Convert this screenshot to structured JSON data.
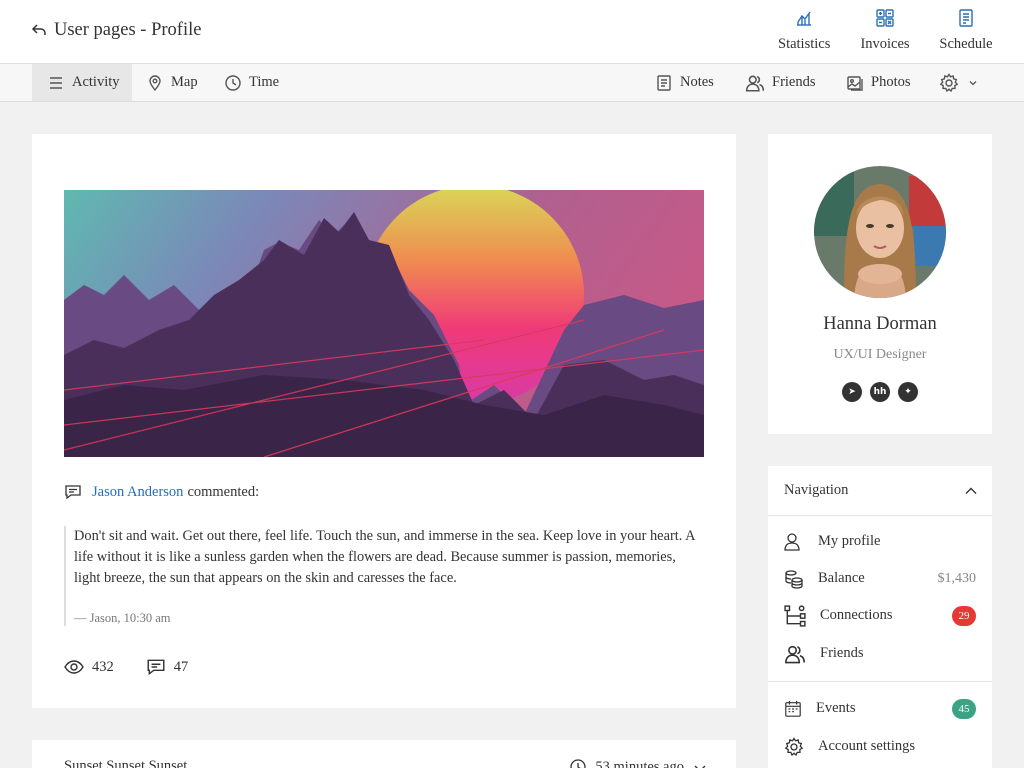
{
  "header": {
    "title": "User pages - Profile",
    "actions": [
      {
        "label": "Statistics",
        "icon": "chart-icon"
      },
      {
        "label": "Invoices",
        "icon": "grid-icon"
      },
      {
        "label": "Schedule",
        "icon": "document-icon"
      }
    ]
  },
  "subnav": {
    "left": [
      {
        "label": "Activity",
        "icon": "menu-icon",
        "active": true
      },
      {
        "label": "Map",
        "icon": "map-pin-icon"
      },
      {
        "label": "Time",
        "icon": "clock-icon"
      }
    ],
    "right": [
      {
        "label": "Notes",
        "icon": "notes-icon"
      },
      {
        "label": "Friends",
        "icon": "users-icon"
      },
      {
        "label": "Photos",
        "icon": "photo-icon"
      }
    ],
    "settings_icon": "gear-icon"
  },
  "post": {
    "author": "Jason Anderson",
    "action": "commented:",
    "quote": "Don't sit and wait. Get out there, feel life. Touch the sun, and immerse in the sea. Keep love in your heart. A life without it is like a sunless garden when the flowers are dead. Because summer is passion, memories, light breeze, the sun that appears on the skin and caresses the face.",
    "footer": "— Jason, 10:30 am",
    "views": "432",
    "comments": "47"
  },
  "post2": {
    "title": "Sunset Sunset Sunset",
    "time": "53 minutes ago"
  },
  "profile": {
    "name": "Hanna Dorman",
    "role": "UX/UI Designer",
    "socials": [
      {
        "name": "telegram-icon",
        "glyph": "➤"
      },
      {
        "name": "hh-icon",
        "glyph": "hh"
      },
      {
        "name": "twitter-icon",
        "glyph": "✦"
      }
    ]
  },
  "navigation": {
    "title": "Navigation",
    "items": [
      {
        "label": "My profile",
        "icon": "user-icon"
      },
      {
        "label": "Balance",
        "icon": "coins-icon",
        "value": "$1,430"
      },
      {
        "label": "Connections",
        "icon": "tree-icon",
        "badge": "29"
      },
      {
        "label": "Friends",
        "icon": "users-icon"
      },
      {
        "label": "Events",
        "icon": "calendar-icon",
        "badge": "45"
      },
      {
        "label": "Account settings",
        "icon": "gear-icon"
      }
    ]
  },
  "colors": {
    "link": "#1f6fc4",
    "badge_danger": "#e53935",
    "badge_success": "#3aa383"
  }
}
